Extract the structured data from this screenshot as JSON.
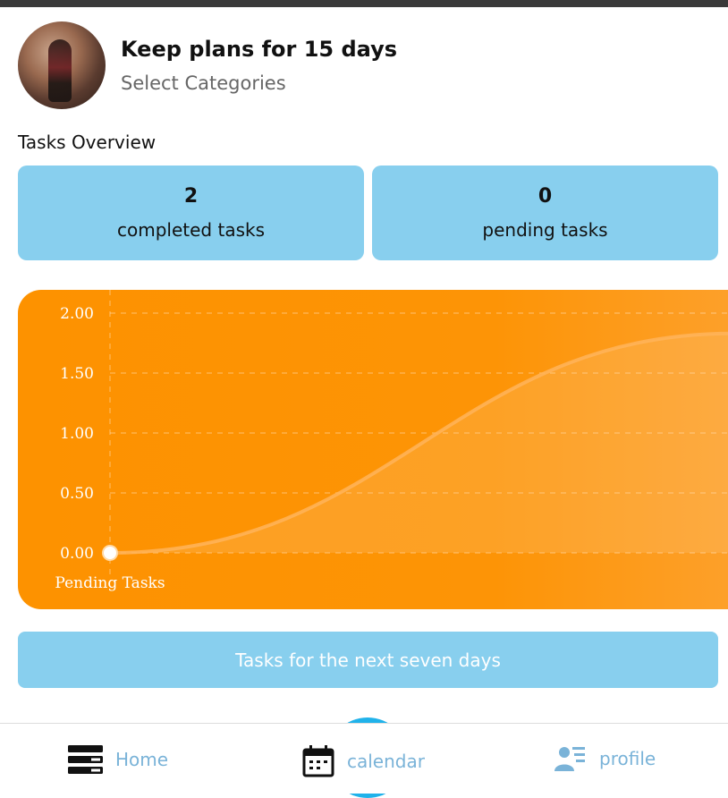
{
  "header": {
    "title": "Keep plans for 15 days",
    "subtitle": "Select Categories"
  },
  "overview": {
    "title": "Tasks Overview",
    "completed": {
      "value": "2",
      "label": "completed tasks"
    },
    "pending": {
      "value": "0",
      "label": "pending tasks"
    }
  },
  "chart_data": {
    "type": "line",
    "y_ticks": [
      "2.00",
      "1.50",
      "1.00",
      "0.50",
      "0.00"
    ],
    "ylim": [
      0,
      2
    ],
    "x_label": "Pending Tasks",
    "grid": true,
    "series": [
      {
        "x": [
          0,
          1
        ],
        "values": [
          0,
          1.83
        ]
      }
    ],
    "colors": {
      "background": "#fd9200",
      "line": "#ffb45a",
      "point": "#ffffff"
    }
  },
  "next_days_button": "Tasks for the next seven days",
  "nav": {
    "home": {
      "label": "Home",
      "icon": "home-icon"
    },
    "calendar": {
      "label": "calendar",
      "icon": "calendar-icon"
    },
    "profile": {
      "label": "profile",
      "icon": "profile-icon"
    }
  }
}
